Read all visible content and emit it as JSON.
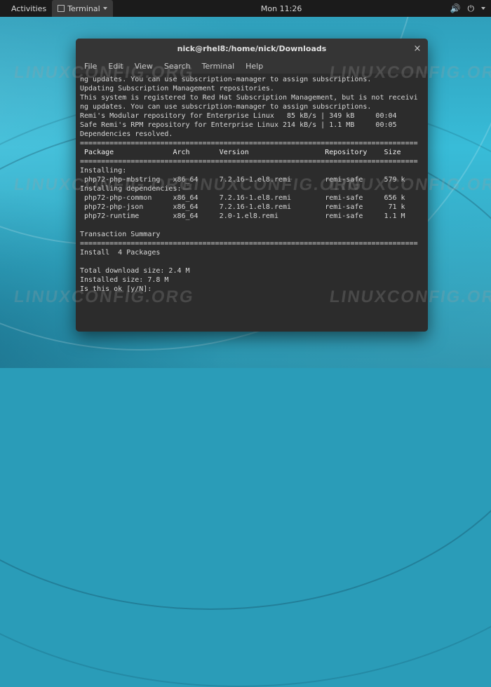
{
  "topbar": {
    "activities": "Activities",
    "app_label": "Terminal",
    "clock": "Mon 11:26"
  },
  "window": {
    "title": "nick@rhel8:/home/nick/Downloads",
    "menu": [
      "File",
      "Edit",
      "View",
      "Search",
      "Terminal",
      "Help"
    ]
  },
  "terminal": {
    "lines_pre": "ng updates. You can use subscription-manager to assign subscriptions.\nUpdating Subscription Management repositories.\nThis system is registered to Red Hat Subscription Management, but is not receivi\nng updates. You can use subscription-manager to assign subscriptions.\nRemi's Modular repository for Enterprise Linux   85 kB/s | 349 kB     00:04\nSafe Remi's RPM repository for Enterprise Linux 214 kB/s | 1.1 MB     00:05\nDependencies resolved.",
    "divider": "================================================================================",
    "header": " Package              Arch       Version                  Repository    Size",
    "section_installing": "Installing:",
    "row1": " php72-php-mbstring   x86_64     7.2.16-1.el8.remi        remi-safe     579 k",
    "section_deps": "Installing dependencies:",
    "row2": " php72-php-common     x86_64     7.2.16-1.el8.remi        remi-safe     656 k",
    "row3": " php72-php-json       x86_64     7.2.16-1.el8.remi        remi-safe      71 k",
    "row4": " php72-runtime        x86_64     2.0-1.el8.remi           remi-safe     1.1 M",
    "summary_label": "Transaction Summary",
    "install_count": "Install  4 Packages",
    "dl_size": "Total download size: 2.4 M",
    "inst_size": "Installed size: 7.8 M",
    "prompt": "Is this ok [y/N]: "
  },
  "watermark": "LINUXCONFIG.ORG"
}
